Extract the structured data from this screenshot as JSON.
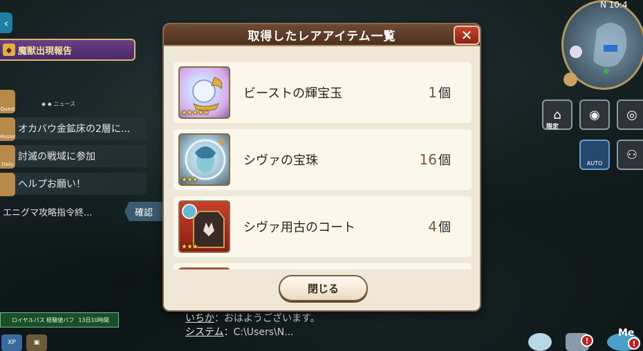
{
  "dialog": {
    "title": "取得したレアアイテム一覧",
    "close_x": "✕",
    "close_button": "閉じる",
    "items": [
      {
        "name": "ビーストの輝宝玉",
        "qty": "1",
        "unit": "個",
        "stars": "★★★★★",
        "rarity": 5
      },
      {
        "name": "シヴァの宝珠",
        "qty": "16",
        "unit": "個",
        "stars": "★★★",
        "rarity": 3
      },
      {
        "name": "シヴァ用古のコート",
        "qty": "4",
        "unit": "個",
        "stars": "★★★",
        "rarity": 3
      }
    ]
  },
  "left_hud": {
    "beast_report": "魔獣出現報告",
    "quest_tabs": [
      "Quest",
      "Mission",
      "Daily"
    ],
    "news_small": "◆ ◆ ニュース",
    "quests": [
      "オカバウ金鉱床の2層に...",
      "討滅の戦域に参加",
      "ヘルプお願い！"
    ],
    "enigma": "エニグマ攻略指令終...",
    "confirm": "確認",
    "royal_pass": "ロイヤルパス 経験値バフ",
    "royal_time": "13日10時間",
    "xp_label": "XP"
  },
  "chat": [
    {
      "speaker": "いちか",
      "text": "：おはようございます。"
    },
    {
      "speaker": "システム",
      "text": "：C:\\Users\\N..."
    }
  ],
  "right_hud": {
    "time": "N 10:4",
    "limited": "限定",
    "auto": "AUTO",
    "me": "Me",
    "notif": "!"
  },
  "colors": {
    "dialog_bg": "#efe7d7",
    "header_bg": "#5a3a28",
    "close_red": "#b03a24",
    "qty_brown": "#7a5a34",
    "star_gold": "#ffd630"
  }
}
